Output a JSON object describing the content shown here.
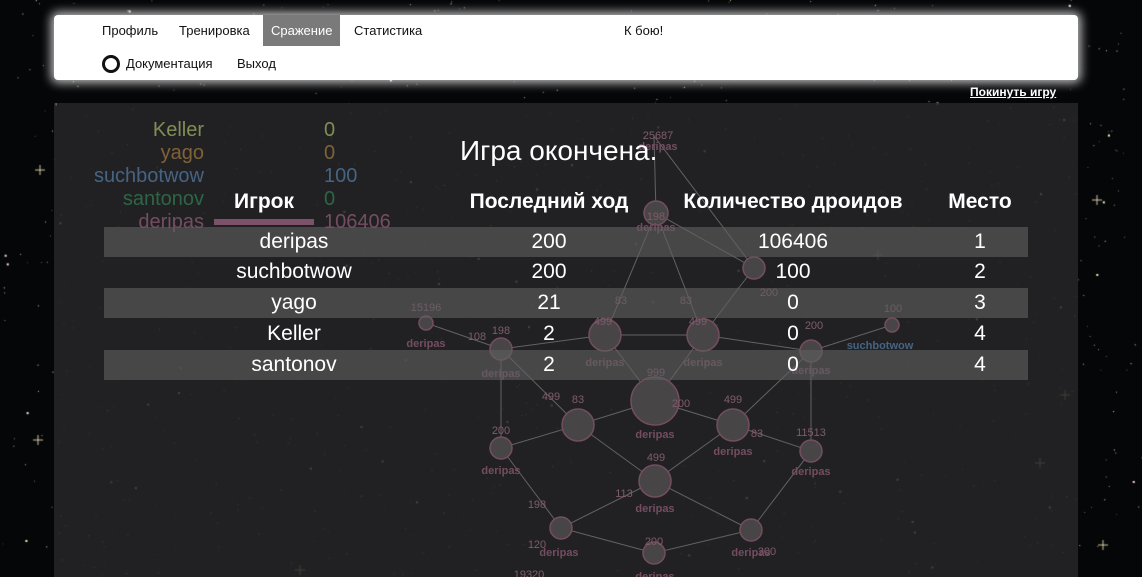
{
  "nav": {
    "items": [
      {
        "label": "Профиль",
        "active": false
      },
      {
        "label": "Тренировка",
        "active": false
      },
      {
        "label": "Сражение",
        "active": true
      },
      {
        "label": "Статистика",
        "active": false
      }
    ],
    "center_label": "К бою!",
    "docs_label": "Документация",
    "docs_icon": "spiral-logo-icon",
    "exit_label": "Выход"
  },
  "leave_game_label": "Покинуть игру",
  "legend": [
    {
      "name": "Keller",
      "score": "0",
      "color": "#8b9a5a"
    },
    {
      "name": "yago",
      "score": "0",
      "color": "#8a6a3a"
    },
    {
      "name": "suchbotwow",
      "score": "100",
      "color": "#4a6c8f"
    },
    {
      "name": "santonov",
      "score": "0",
      "color": "#2f6e4a"
    },
    {
      "name": "deripas",
      "score": "106406",
      "color": "#7d5268"
    }
  ],
  "results": {
    "title": "Игра окончена.",
    "headers": [
      "Игрок",
      "Последний ход",
      "Количество дроидов",
      "Место"
    ],
    "rows": [
      {
        "player": "deripas",
        "last_move": "200",
        "droids": "106406",
        "place": "1"
      },
      {
        "player": "suchbotwow",
        "last_move": "200",
        "droids": "100",
        "place": "2"
      },
      {
        "player": "yago",
        "last_move": "21",
        "droids": "0",
        "place": "3"
      },
      {
        "player": "Keller",
        "last_move": "2",
        "droids": "0",
        "place": "4"
      },
      {
        "player": "santonov",
        "last_move": "2",
        "droids": "0",
        "place": "4"
      }
    ]
  },
  "map": {
    "nodes": [
      {
        "value": "25687",
        "owner": "deripas"
      },
      {
        "value": "198",
        "owner": "deripas"
      },
      {
        "value": "200",
        "owner": "deripas"
      },
      {
        "value": "15196",
        "owner": "deripas"
      },
      {
        "value": "198",
        "owner": "deripas"
      },
      {
        "value": "108",
        "owner": ""
      },
      {
        "value": "499",
        "owner": "deripas"
      },
      {
        "value": "83",
        "owner": ""
      },
      {
        "value": "499",
        "owner": "deripas"
      },
      {
        "value": "83",
        "owner": ""
      },
      {
        "value": "200",
        "owner": "deripas"
      },
      {
        "value": "100",
        "owner": "suchbotwow"
      },
      {
        "value": "999",
        "owner": "deripas"
      },
      {
        "value": "200",
        "owner": ""
      },
      {
        "value": "83",
        "owner": ""
      },
      {
        "value": "499",
        "owner": "deripas"
      },
      {
        "value": "499",
        "owner": "deripas"
      },
      {
        "value": "83",
        "owner": ""
      },
      {
        "value": "200",
        "owner": "deripas"
      },
      {
        "value": "11513",
        "owner": "deripas"
      },
      {
        "value": "499",
        "owner": "deripas"
      },
      {
        "value": "113",
        "owner": ""
      },
      {
        "value": "198",
        "owner": ""
      },
      {
        "value": "200",
        "owner": ""
      },
      {
        "value": "120",
        "owner": "deripas"
      },
      {
        "value": "200",
        "owner": "deripas"
      },
      {
        "value": "200",
        "owner": "deripas"
      },
      {
        "value": "19320",
        "owner": ""
      }
    ],
    "owner_color": "#7d5268",
    "neutral_color": "#8a6272"
  }
}
